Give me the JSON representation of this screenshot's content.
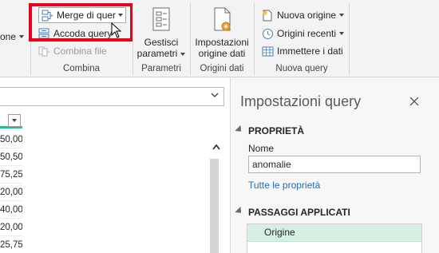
{
  "ribbon": {
    "partial_left_label": "one",
    "combina": {
      "merge_label": "Merge di query",
      "append_label": "Accoda query",
      "combine_files_label": "Combina file",
      "group_label": "Combina"
    },
    "parametri": {
      "manage_label_line1": "Gestisci",
      "manage_label_line2": "parametri",
      "group_label": "Parametri"
    },
    "origini_dati": {
      "settings_label_line1": "Impostazioni",
      "settings_label_line2": "origine dati",
      "group_label": "Origini dati"
    },
    "nuova_query": {
      "new_source_label": "Nuova origine",
      "recent_sources_label": "Origini recenti",
      "enter_data_label": "Immettere i dati",
      "group_label": "Nuova query"
    }
  },
  "grid": {
    "values": [
      "50,00",
      "50,50",
      "75,25",
      "20,00",
      "40,00",
      "20,00",
      "25,75"
    ]
  },
  "query_settings": {
    "title": "Impostazioni query",
    "properties_heading": "PROPRIETÀ",
    "name_label": "Nome",
    "name_value": "anomalie",
    "all_properties_link": "Tutte le proprietà",
    "applied_steps_heading": "PASSAGGI APPLICATI",
    "steps": [
      "Origine"
    ]
  },
  "colors": {
    "highlight": "#e8001c",
    "selected_step": "#d7efe2",
    "column_accent": "#2fb59b",
    "link": "#1f6fb4"
  },
  "icons": [
    "merge-icon",
    "append-icon",
    "combine-files-icon",
    "manage-parameters-icon",
    "datasource-settings-icon",
    "new-source-icon",
    "recent-sources-icon",
    "enter-data-icon",
    "close-icon",
    "chevron-down-icon",
    "scroll-up-icon",
    "mouse-cursor-icon"
  ]
}
